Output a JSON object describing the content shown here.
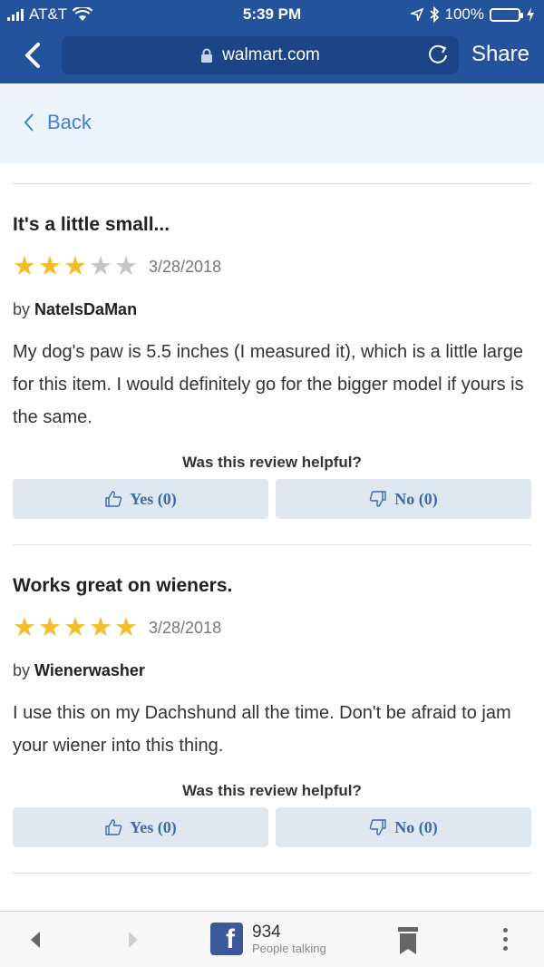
{
  "status_bar": {
    "carrier": "AT&T",
    "time": "5:39 PM",
    "battery": "100%",
    "battery_level": 1.0
  },
  "browser": {
    "url": "walmart.com",
    "share_label": "Share"
  },
  "page": {
    "back_label": "Back"
  },
  "reviews": [
    {
      "title": "It's a little small...",
      "rating": 3,
      "rating_max": 5,
      "date": "3/28/2018",
      "by": "by",
      "author": "NateIsDaMan",
      "body": "My dog's paw is 5.5 inches (I measured it), which is a little large for this item. I would definitely go for the bigger model if yours is the same.",
      "helpful_question": "Was this review helpful?",
      "yes_label": "Yes (0)",
      "no_label": "No (0)"
    },
    {
      "title": "Works great on wieners.",
      "rating": 5,
      "rating_max": 5,
      "date": "3/28/2018",
      "by": "by",
      "author": "Wienerwasher",
      "body": "I use this on my Dachshund all the time. Don't be afraid to jam your wiener into this thing.",
      "helpful_question": "Was this review helpful?",
      "yes_label": "Yes (0)",
      "no_label": "No (0)"
    }
  ],
  "toolbar": {
    "fb_count": "934",
    "fb_sub": "People talking"
  },
  "colors": {
    "chrome": "#24539d",
    "link": "#3c83d6",
    "star": "#f3bc2b",
    "vote_bg": "#dfe8f0"
  }
}
